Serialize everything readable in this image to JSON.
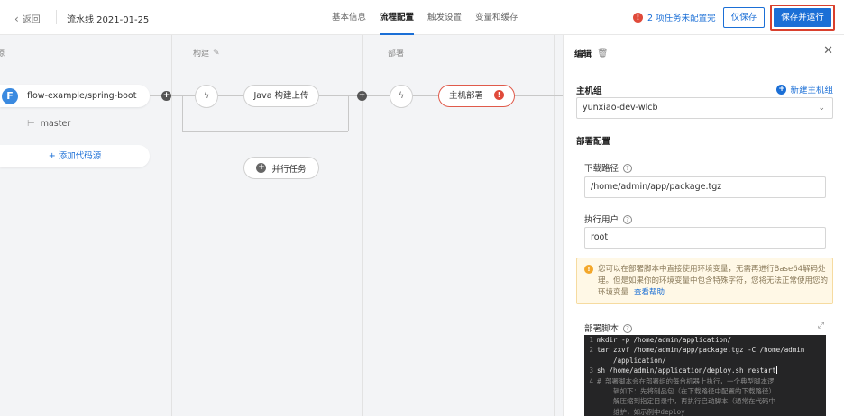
{
  "header": {
    "back_label": "返回",
    "pipeline_title": "流水线 2021-01-25",
    "tabs": [
      {
        "label": "基本信息",
        "active": false
      },
      {
        "label": "流程配置",
        "active": true
      },
      {
        "label": "触发设置",
        "active": false
      },
      {
        "label": "变量和缓存",
        "active": false
      }
    ],
    "warning_text": "2 项任务未配置完",
    "save_label": "仅保存",
    "save_run_label": "保存并运行"
  },
  "canvas": {
    "stage_source_title": "源",
    "stage_build_title": "构建",
    "stage_deploy_title": "部署",
    "source_name": "flow-example/spring-boot",
    "source_logo_letter": "F",
    "branch": "master",
    "add_source_label": "+ 添加代码源",
    "build_job": "Java 构建上传",
    "parallel_label": "并行任务",
    "deploy_job": "主机部署"
  },
  "panel": {
    "title": "编辑",
    "host_group_label": "主机组",
    "new_host_group_label": "新建主机组",
    "host_group_value": "yunxiao-dev-wlcb",
    "deploy_config_label": "部署配置",
    "download_path_label": "下载路径",
    "download_path_value": "/home/admin/app/package.tgz",
    "exec_user_label": "执行用户",
    "exec_user_value": "root",
    "notice_text": "您可以在部署脚本中直接使用环境变量，无需再进行Base64解码处理。但是如果你的环境变量中包含特殊字符，您将无法正常使用您的环境变量",
    "notice_link": "查看帮助",
    "script_label": "部署脚本",
    "script_lines": [
      {
        "num": "1",
        "text": "mkdir -p /home/admin/application/",
        "comment": false
      },
      {
        "num": "2",
        "text": "tar zxvf /home/admin/app/package.tgz -C /home/admin",
        "comment": false
      },
      {
        "num": "",
        "text": "    /application/",
        "comment": false
      },
      {
        "num": "3",
        "text": "sh /home/admin/application/deploy.sh restart",
        "comment": false
      },
      {
        "num": "4",
        "text": "# 部署脚本会在部署组的每台机器上执行，一个典型脚本逻",
        "comment": true
      },
      {
        "num": "",
        "text": "    辑如下：先将制品包（在下载路径中配置的下载路径）",
        "comment": true
      },
      {
        "num": "",
        "text": "    解压缩到指定目录中，再执行启动脚本（通常在代码中",
        "comment": true
      },
      {
        "num": "",
        "text": "    维护，如示例中deploy",
        "comment": true
      }
    ]
  },
  "colors": {
    "primary": "#1b6fd6",
    "error": "#e04a3a",
    "highlight_border": "#d9402d",
    "notice_bg": "#fff8e6",
    "code_bg": "#252526"
  }
}
